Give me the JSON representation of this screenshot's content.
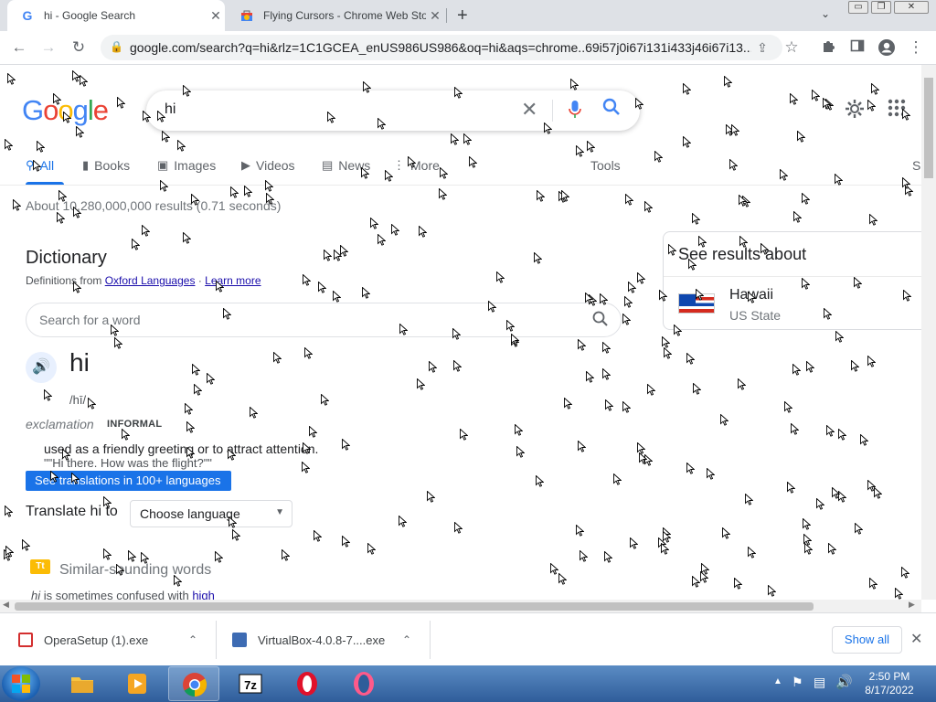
{
  "tabs": [
    {
      "title": "hi - Google Search",
      "favicon": "G",
      "active": true
    },
    {
      "title": "Flying Cursors - Chrome Web Sto",
      "favicon": "chrome-webstore-icon",
      "active": false
    }
  ],
  "window_controls": {
    "minimize": "▭",
    "restore": "❐",
    "close": "✕"
  },
  "address_bar": {
    "url": "google.com/search?q=hi&rlz=1C1GCEA_enUS986US986&oq=hi&aqs=chrome..69i57j0i67i131i433j46i67i13..."
  },
  "google": {
    "logo_letters": [
      "G",
      "o",
      "o",
      "g",
      "l",
      "e"
    ],
    "query": "hi",
    "nav_tabs": [
      {
        "label": "All",
        "icon": "search-icon",
        "active": true
      },
      {
        "label": "Books",
        "icon": "book-icon"
      },
      {
        "label": "Images",
        "icon": "image-icon"
      },
      {
        "label": "Videos",
        "icon": "video-icon"
      },
      {
        "label": "News",
        "icon": "news-icon"
      },
      {
        "label": "More",
        "icon": "more-icon"
      }
    ],
    "tools_label": "Tools",
    "truncated_label": "S",
    "result_stats": "About 10,280,000,000 results (0.71 seconds)"
  },
  "dictionary": {
    "heading": "Dictionary",
    "defs_from_prefix": "Definitions from",
    "defs_source": "Oxford Languages",
    "defs_sep": "·",
    "learn_more": "Learn more",
    "search_placeholder": "Search for a word",
    "word": "hi",
    "phonetic": "/hī/",
    "part_of_speech": "exclamation",
    "register": "INFORMAL",
    "definition": "used as a friendly greeting or to attract attention.",
    "example": "\"\"Hi there. How was the flight?\"\"",
    "translations_button": "See translations in 100+ languages",
    "translate_label": "Translate hi to",
    "language_select": "Choose language",
    "similar_icon_text": "Tt",
    "similar_heading": "Similar-sounding words",
    "confused_prefix": "hi",
    "confused_middle": " is sometimes confused with ",
    "confused_word": "high"
  },
  "see_results": {
    "heading": "See results about",
    "name": "Hawaii",
    "subtitle": "US State"
  },
  "downloads": [
    {
      "filename": "OperaSetup (1).exe"
    },
    {
      "filename": "VirtualBox-4.0.8-7....exe"
    }
  ],
  "show_all": "Show all",
  "clock": {
    "time": "2:50 PM",
    "date": "8/17/2022"
  },
  "colors": {
    "google_blue": "#1a73e8",
    "link": "#1a0dab",
    "tab_strip": "#dee1e6"
  }
}
